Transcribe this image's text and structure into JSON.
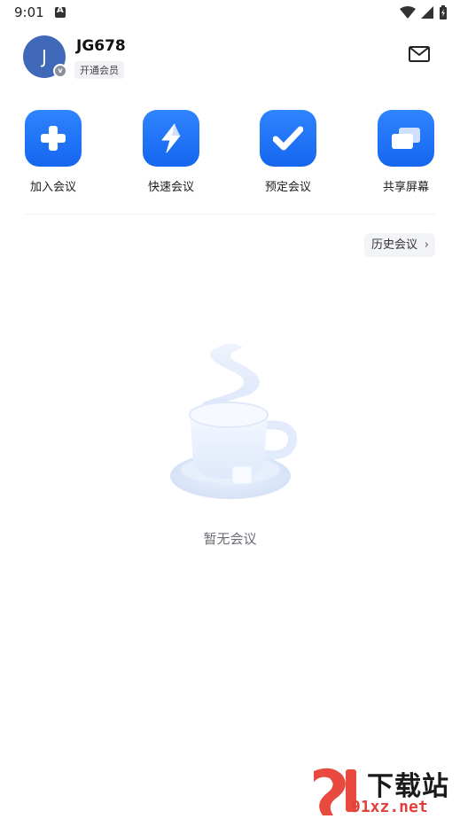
{
  "status_bar": {
    "time": "9:01"
  },
  "profile": {
    "avatar_letter": "J",
    "username": "JG678",
    "member_label": "开通会员",
    "vip_mark": "v"
  },
  "actions": [
    {
      "label": "加入会议",
      "icon": "plus-icon"
    },
    {
      "label": "快速会议",
      "icon": "lightning-icon"
    },
    {
      "label": "预定会议",
      "icon": "check-icon"
    },
    {
      "label": "共享屏幕",
      "icon": "screen-share-icon"
    }
  ],
  "history": {
    "label": "历史会议"
  },
  "empty_state": {
    "text": "暂无会议"
  },
  "watermark": {
    "brand_top": "下载站",
    "brand_bottom": "91xz.net"
  },
  "colors": {
    "accent": "#1f74f4",
    "avatar_bg": "#3f68b8",
    "empty_text": "#6b6f76"
  }
}
